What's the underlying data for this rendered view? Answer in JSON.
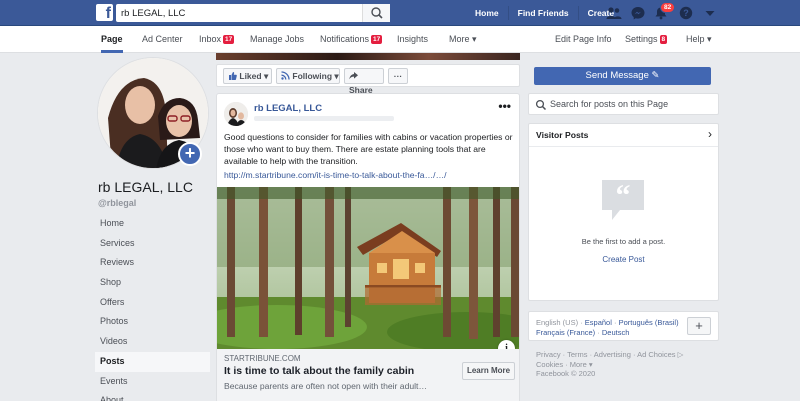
{
  "topbar": {
    "search_value": "rb LEGAL, LLC",
    "nav": [
      "Home",
      "Find Friends",
      "Create"
    ],
    "notifications_count": "82",
    "brand_color": "#3b5998"
  },
  "tabs": [
    {
      "label": "Page",
      "active": true
    },
    {
      "label": "Ad Center"
    },
    {
      "label": "Inbox",
      "badge": "17"
    },
    {
      "label": "Manage Jobs"
    },
    {
      "label": "Notifications",
      "badge": "17"
    },
    {
      "label": "Insights"
    },
    {
      "label": "More ▾"
    },
    {
      "label": "Edit Page Info"
    },
    {
      "label": "Settings",
      "badge": "8"
    },
    {
      "label": "Help ▾"
    }
  ],
  "profile": {
    "name": "rb LEGAL, LLC",
    "handle": "@rblegal"
  },
  "left_nav": [
    "Home",
    "Services",
    "Reviews",
    "Shop",
    "Offers",
    "Photos",
    "Videos",
    "Posts",
    "Events",
    "About"
  ],
  "left_nav_active": "Posts",
  "actions": {
    "liked": "Liked",
    "following": "Following",
    "share": "Share",
    "more": "···",
    "send_message": "Send Message"
  },
  "post": {
    "author": "rb LEGAL, LLC",
    "text": "Good questions to consider for families with cabins or vacation properties or those who want to buy them. There are estate planning tools that are available to help with the transition.",
    "link": "http://m.startribune.com/it-is-time-to-talk-about-the-fa…/…/",
    "domain": "STARTRIBUNE.COM",
    "title": "It is time to talk about the family cabin",
    "description": "Because parents are often not open with their adult…",
    "learn_more": "Learn More",
    "info": "i",
    "more": "•••"
  },
  "right": {
    "search_placeholder": "Search for posts on this Page",
    "visitor_title": "Visitor Posts",
    "visitor_empty": "Be the first to add a post.",
    "create_post": "Create Post",
    "languages": {
      "current": "English (US)",
      "options": [
        "Español",
        "Português (Brasil)",
        "Français (France)",
        "Deutsch"
      ]
    },
    "footer_line1": "Privacy · Terms · Advertising · Ad Choices ▷",
    "footer_line2": "Cookies · More ▾",
    "footer_line3": "Facebook © 2020"
  }
}
